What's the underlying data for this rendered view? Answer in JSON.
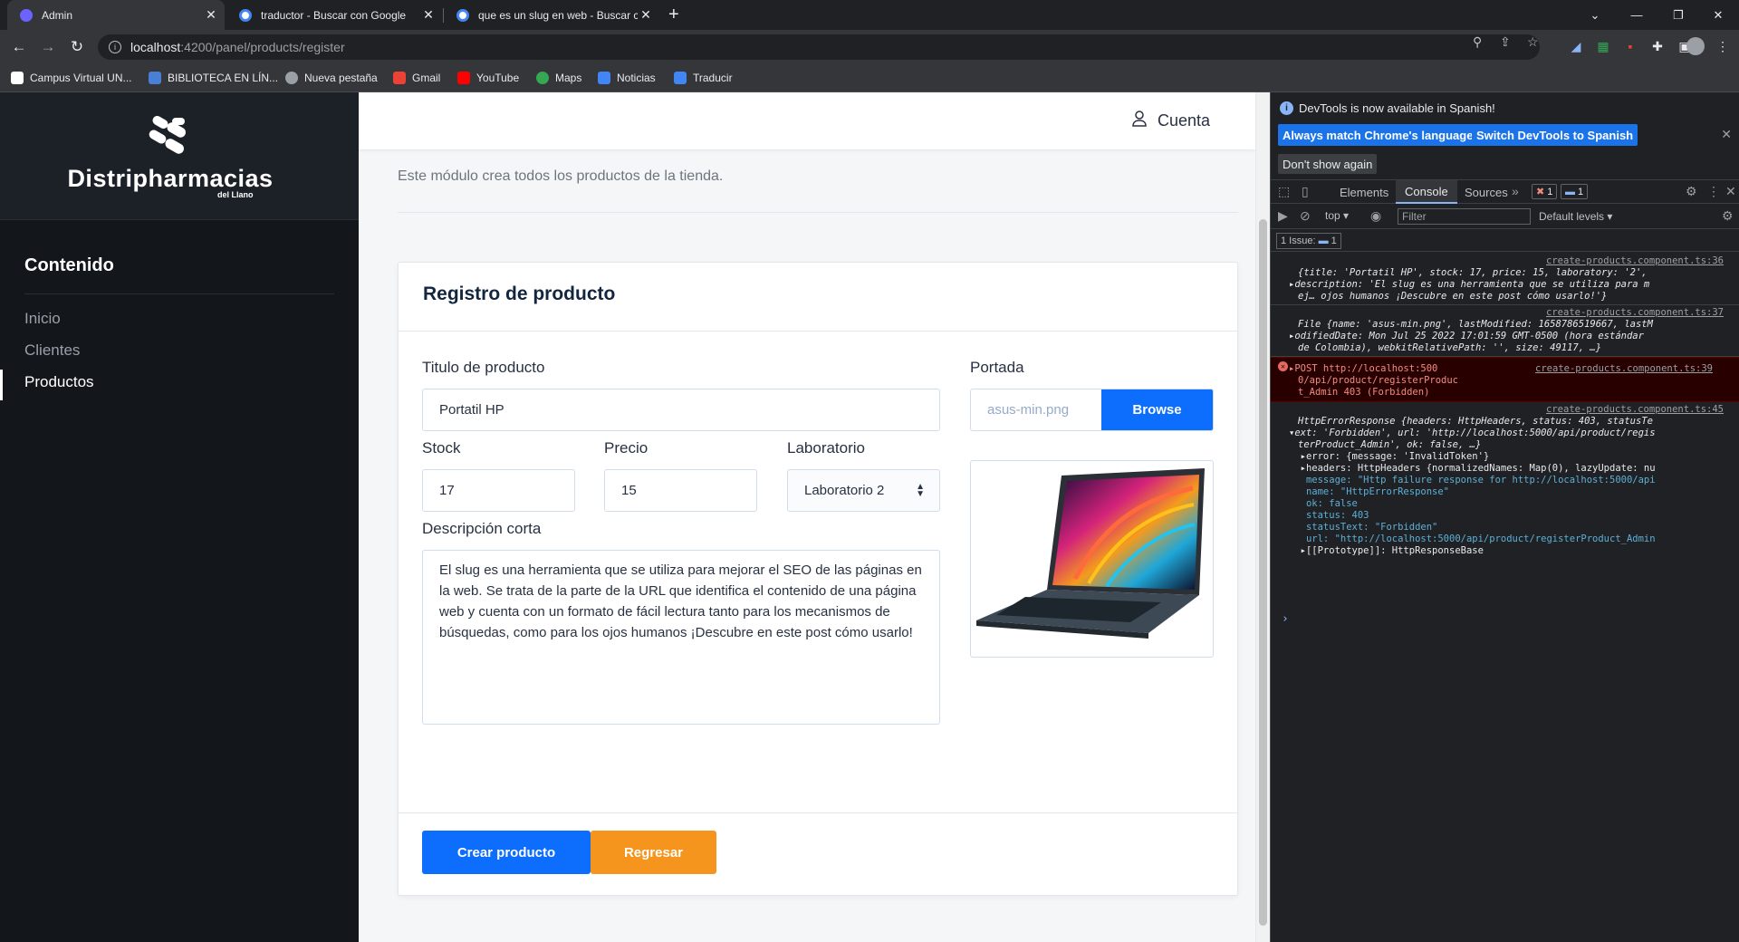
{
  "browser": {
    "tabs": [
      {
        "title": "Admin",
        "fav_color": "#6c63ff"
      },
      {
        "title": "traductor - Buscar con Google",
        "fav_color": "#4285f4"
      },
      {
        "title": "que es un slug en web - Buscar c",
        "fav_color": "#4285f4"
      }
    ],
    "new_tab": "+",
    "url_host": "localhost",
    "url_path": ":4200/panel/products/register",
    "bookmarks": [
      {
        "label": "Campus Virtual UN...",
        "color": "#ffffff"
      },
      {
        "label": "BIBLIOTECA EN LÍN...",
        "color": "#4a7fd6"
      },
      {
        "label": "Nueva pestaña",
        "color": "#9aa0a6"
      },
      {
        "label": "Gmail",
        "color": "#ea4335"
      },
      {
        "label": "YouTube",
        "color": "#ff0000"
      },
      {
        "label": "Maps",
        "color": "#34a853"
      },
      {
        "label": "Noticias",
        "color": "#4285f4"
      },
      {
        "label": "Traducir",
        "color": "#4285f4"
      }
    ]
  },
  "sidebar": {
    "logo": "Distripharmacias",
    "logo_sub": "del Llano",
    "heading": "Contenido",
    "items": [
      "Inicio",
      "Clientes",
      "Productos"
    ]
  },
  "header": {
    "account": "Cuenta"
  },
  "main": {
    "description": "Este módulo crea todos los productos de la tienda.",
    "card_title": "Registro de producto",
    "title_label": "Titulo de producto",
    "title_value": "Portatil HP",
    "cover_label": "Portada",
    "cover_file": "asus-min.png",
    "browse": "Browse",
    "stock_label": "Stock",
    "stock_value": "17",
    "price_label": "Precio",
    "price_value": "15",
    "lab_label": "Laboratorio",
    "lab_value": "Laboratorio 2",
    "short_desc_label": "Descripción corta",
    "short_desc_value": "El slug es una herramienta que se utiliza para mejorar el SEO de las páginas en la web. Se trata de la parte de la URL que identifica el contenido de una página web y cuenta con un formato de fácil lectura tanto para los mecanismos de búsquedas, como para los ojos humanos ¡Descubre en este post cómo usarlo!",
    "create_btn": "Crear producto",
    "back_btn": "Regresar",
    "colors": {
      "primary": "#0d6efd",
      "warning": "#f6951e"
    }
  },
  "devtools": {
    "notice": "DevTools is now available in Spanish!",
    "btn_match": "Always match Chrome's language",
    "btn_switch": "Switch DevTools to Spanish",
    "btn_dont": "Don't show again",
    "tabs": [
      "Elements",
      "Console",
      "Sources"
    ],
    "err_badge": "1",
    "info_badge": "1",
    "context": "top",
    "filter_placeholder": "Filter",
    "levels": "Default levels",
    "issues": "1 Issue:",
    "issues_count": "1",
    "messages": [
      {
        "src": "create-products.component.ts:36",
        "lines": [
          "{title: 'Portatil HP', stock: 17, price: 15, laboratory: '2',",
          "▸description: 'El slug es una herramienta que se utiliza para m",
          "ej… ojos humanos ¡Descubre en este post cómo usarlo!'}"
        ]
      },
      {
        "src": "create-products.component.ts:37",
        "lines": [
          "File {name: 'asus-min.png', lastModified: 1658786519667, lastM",
          "▸odifiedDate: Mon Jul 25 2022 17:01:59 GMT-0500 (hora estándar",
          "de Colombia), webkitRelativePath: '', size: 49117, …}"
        ]
      },
      {
        "src": "create-products.component.ts:39",
        "lines": [
          "▸POST http://localhost:500",
          "0/api/product/registerProduc",
          "t_Admin 403 (Forbidden)"
        ],
        "error": true
      },
      {
        "src": "create-products.component.ts:45",
        "lines": [
          "HttpErrorResponse {headers: HttpHeaders, status: 403, statusTe",
          "▾ext: 'Forbidden', url: 'http://localhost:5000/api/product/regis",
          "terProduct_Admin', ok: false, …}",
          "  ▸error: {message: 'InvalidToken'}",
          "  ▸headers: HttpHeaders {normalizedNames: Map(0), lazyUpdate: nu",
          "   message: \"Http failure response for http://localhost:5000/api",
          "   name: \"HttpErrorResponse\"",
          "   ok: false",
          "   status: 403",
          "   statusText: \"Forbidden\"",
          "   url: \"http://localhost:5000/api/product/registerProduct_Admin",
          "  ▸[[Prototype]]: HttpResponseBase"
        ]
      }
    ],
    "prompt": "›"
  }
}
